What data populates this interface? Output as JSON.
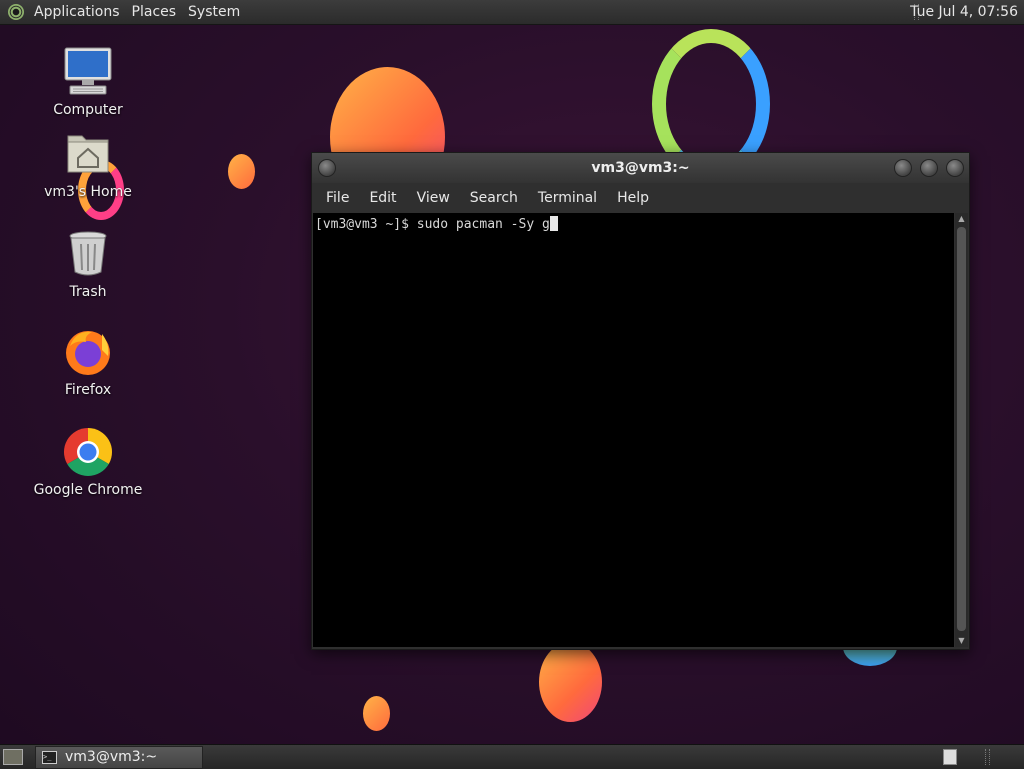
{
  "top_panel": {
    "menus": [
      "Applications",
      "Places",
      "System"
    ],
    "clock": "Tue Jul  4, 07:56"
  },
  "desktop_icons": {
    "computer": "Computer",
    "home": "vm3's Home",
    "trash": "Trash",
    "firefox": "Firefox",
    "chrome": "Google Chrome"
  },
  "terminal": {
    "title": "vm3@vm3:~",
    "menus": [
      "File",
      "Edit",
      "View",
      "Search",
      "Terminal",
      "Help"
    ],
    "prompt": "[vm3@vm3 ~]$ ",
    "command": "sudo pacman -Sy g"
  },
  "taskbar": {
    "task_label": "vm3@vm3:~"
  },
  "colors": {
    "desktop_bg": "#2a0f2b",
    "terminal_bg": "#000000",
    "panel_bg": "#2b2b2b"
  }
}
